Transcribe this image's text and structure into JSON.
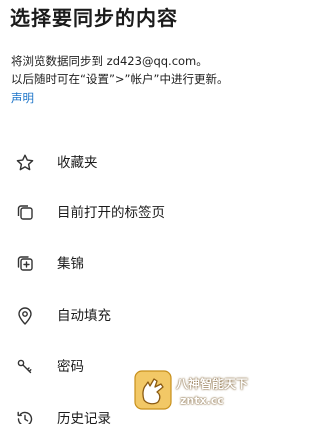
{
  "header": {
    "title": "选择要同步的内容"
  },
  "description": {
    "line1": "将浏览数据同步到 zd423@qq.com。",
    "line2": "以后随时可在“设置”>”帐户”中进行更新。"
  },
  "statement_link": "声明",
  "menu": {
    "items": [
      {
        "label": "收藏夹",
        "icon": "star-icon"
      },
      {
        "label": "目前打开的标签页",
        "icon": "tabs-icon"
      },
      {
        "label": "集锦",
        "icon": "collections-icon"
      },
      {
        "label": "自动填充",
        "icon": "location-pin-icon"
      },
      {
        "label": "密码",
        "icon": "key-icon"
      },
      {
        "label": "历史记录",
        "icon": "history-icon"
      }
    ]
  },
  "watermark": {
    "line1": "八神智能天下",
    "line2": "zntx.cc"
  },
  "colors": {
    "link": "#1a73c8",
    "text": "#1b1b1b",
    "background": "#ffffff"
  }
}
